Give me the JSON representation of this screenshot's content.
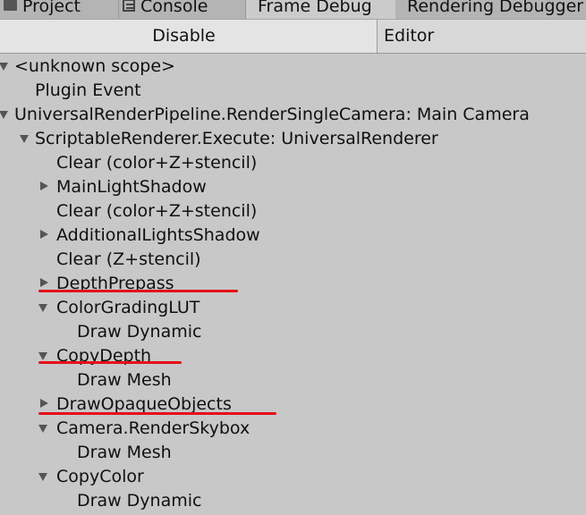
{
  "tabs": {
    "project": "Project",
    "console": "Console",
    "frame_debug": "Frame Debug",
    "rendering_debugger": "Rendering Debugger"
  },
  "toolbar": {
    "disable_label": "Disable",
    "editor_label": "Editor"
  },
  "tree": {
    "items": [
      {
        "label": "<unknown scope>"
      },
      {
        "label": "Plugin Event"
      },
      {
        "label": "UniversalRenderPipeline.RenderSingleCamera: Main Camera"
      },
      {
        "label": "ScriptableRenderer.Execute: UniversalRenderer"
      },
      {
        "label": "Clear (color+Z+stencil)"
      },
      {
        "label": "MainLightShadow"
      },
      {
        "label": "Clear (color+Z+stencil)"
      },
      {
        "label": "AdditionalLightsShadow"
      },
      {
        "label": "Clear (Z+stencil)"
      },
      {
        "label": "DepthPrepass"
      },
      {
        "label": "ColorGradingLUT"
      },
      {
        "label": "Draw Dynamic"
      },
      {
        "label": "CopyDepth"
      },
      {
        "label": "Draw Mesh"
      },
      {
        "label": "DrawOpaqueObjects"
      },
      {
        "label": "Camera.RenderSkybox"
      },
      {
        "label": "Draw Mesh"
      },
      {
        "label": "CopyColor"
      },
      {
        "label": "Draw Dynamic"
      }
    ]
  },
  "colors": {
    "annotation_underline": "#e4101a",
    "panel_background": "#c8c8c8"
  }
}
